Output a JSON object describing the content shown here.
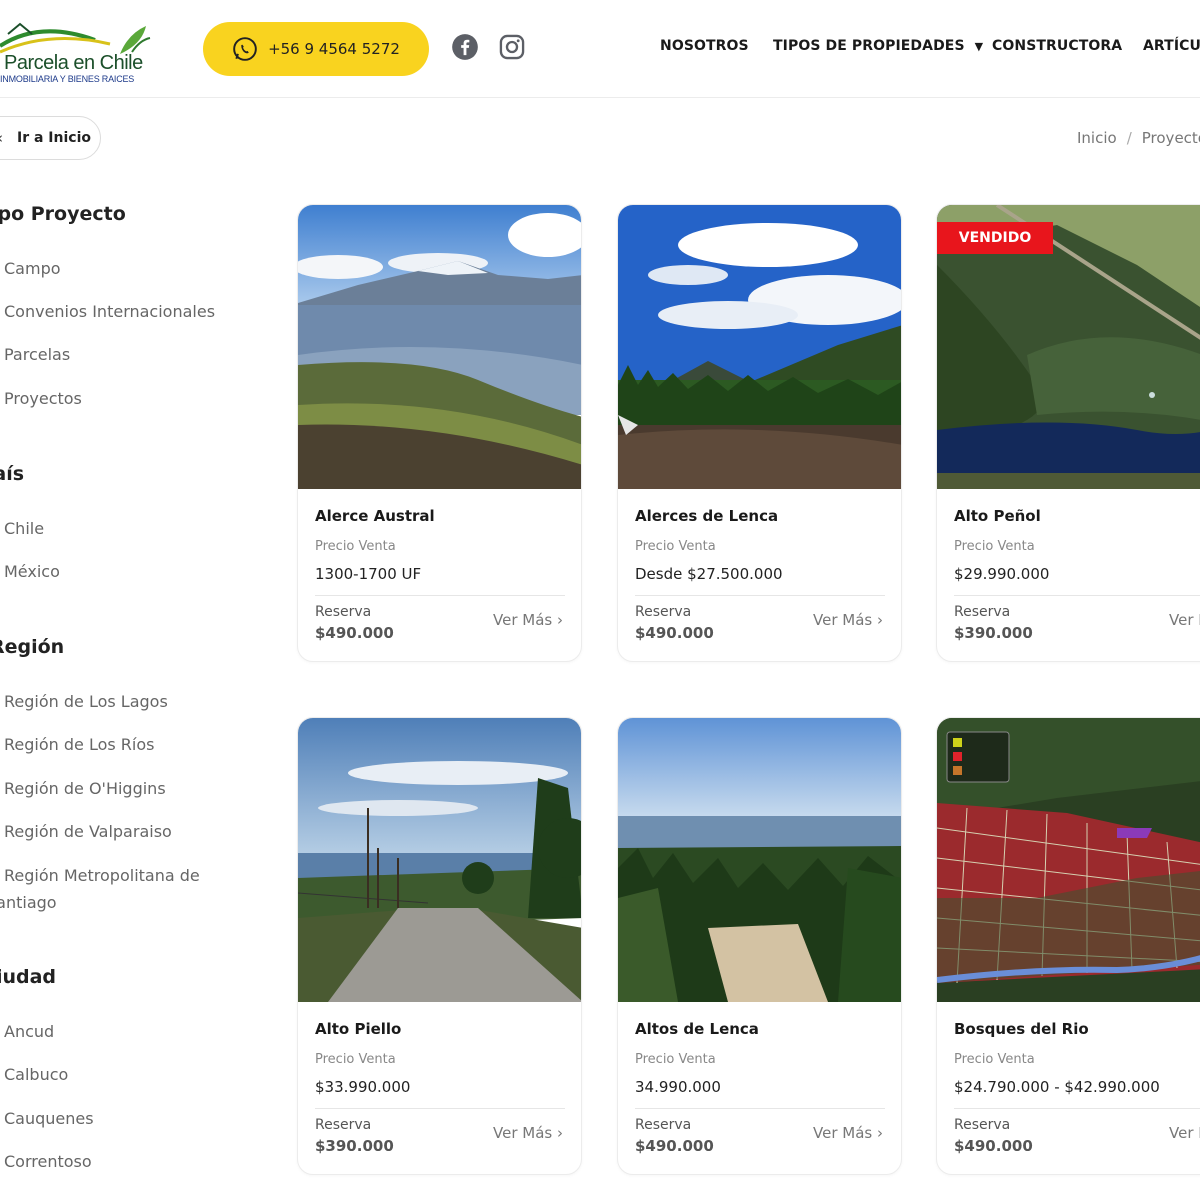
{
  "header": {
    "logo": {
      "title": "Parcela en Chile",
      "subtitle": "INMOBILIARIA Y BIENES RAICES"
    },
    "phone": "+56 9 4564 5272",
    "social": [
      "facebook-icon",
      "instagram-icon"
    ],
    "nav": [
      "NOSOTROS",
      "TIPOS DE PROPIEDADES",
      "CONSTRUCTORA",
      "ARTÍCULOS"
    ]
  },
  "back_button": "Ir a Inicio",
  "breadcrumb": [
    "Inicio",
    "/",
    "Proyectos"
  ],
  "sidebar": {
    "groups": [
      {
        "heading": "Tipo Proyecto",
        "items": [
          "Campo",
          "Convenios Internacionales",
          "Parcelas",
          "Proyectos"
        ]
      },
      {
        "heading": "País",
        "items": [
          "Chile",
          "México"
        ]
      },
      {
        "heading": "Región",
        "items": [
          "Región de Los Lagos",
          "Región de Los Ríos",
          "Región de O'Higgins",
          "Región de Valparaiso",
          "Región Metropolitana de Santiago"
        ]
      },
      {
        "heading": "Ciudad",
        "items": [
          "Ancud",
          "Calbuco",
          "Cauquenes",
          "Correntoso"
        ]
      }
    ]
  },
  "cards": [
    {
      "title": "Alerce Austral",
      "price_label": "Precio Venta",
      "price": "1300-1700 UF",
      "reserve_label": "Reserva",
      "reserve": "$490.000",
      "more": "Ver Más ›",
      "badge": ""
    },
    {
      "title": "Alerces de Lenca",
      "price_label": "Precio Venta",
      "price": "Desde $27.500.000",
      "reserve_label": "Reserva",
      "reserve": "$490.000",
      "more": "Ver Más ›",
      "badge": ""
    },
    {
      "title": "Alto Peñol",
      "price_label": "Precio Venta",
      "price": "$29.990.000",
      "reserve_label": "Reserva",
      "reserve": "$390.000",
      "more": "Ver Más ›",
      "badge": "VENDIDO"
    },
    {
      "title": "Alto Piello",
      "price_label": "Precio Venta",
      "price": "$33.990.000",
      "reserve_label": "Reserva",
      "reserve": "$390.000",
      "more": "Ver Más ›",
      "badge": ""
    },
    {
      "title": "Altos de Lenca",
      "price_label": "Precio Venta",
      "price": "34.990.000",
      "reserve_label": "Reserva",
      "reserve": "$490.000",
      "more": "Ver Más ›",
      "badge": ""
    },
    {
      "title": "Bosques del Rio",
      "price_label": "Precio Venta",
      "price": "$24.790.000 - $42.990.000",
      "reserve_label": "Reserva",
      "reserve": "$490.000",
      "more": "Ver Más ›",
      "badge": ""
    }
  ],
  "colors": {
    "accent": "#f9d31f",
    "sold": "#e8151c",
    "brand_green": "#1b4f2a"
  }
}
